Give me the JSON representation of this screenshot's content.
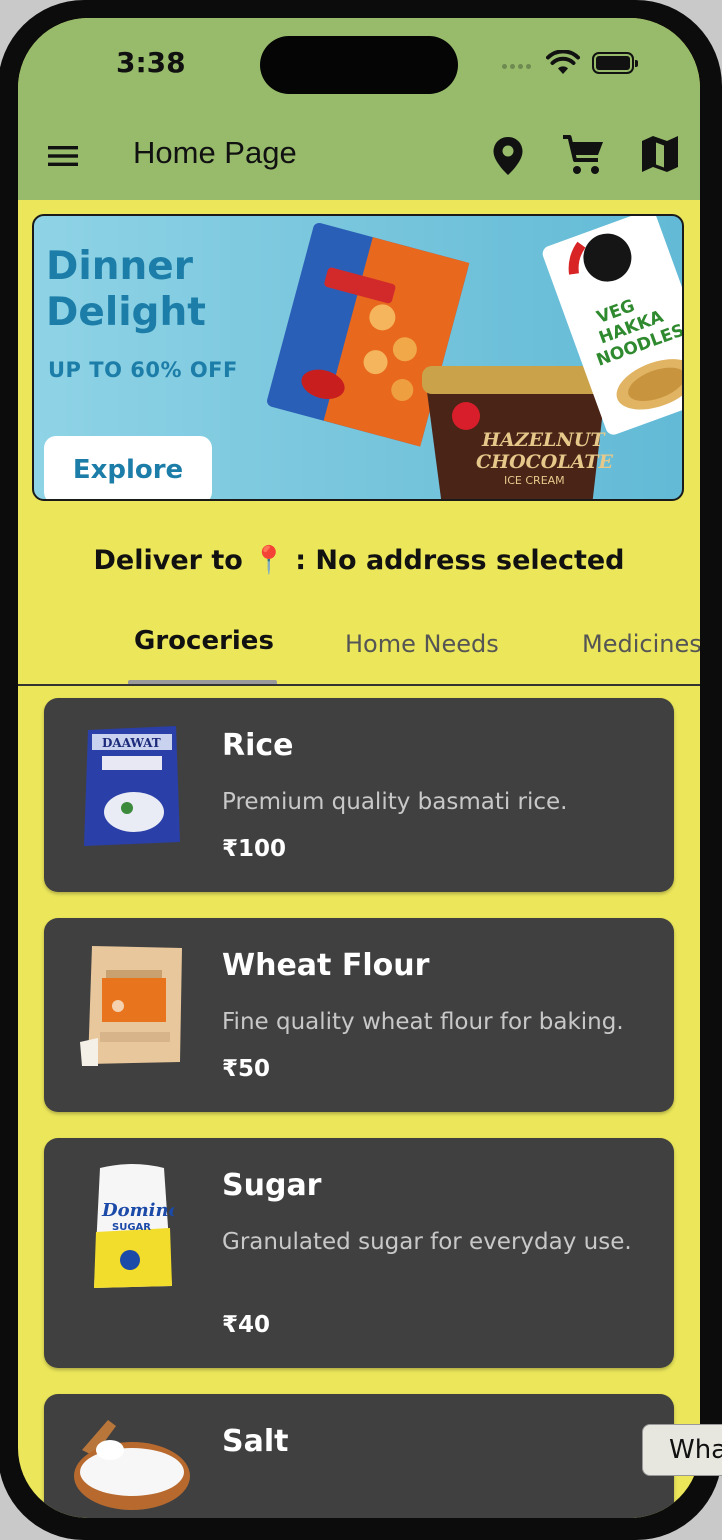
{
  "status_bar": {
    "time": "3:38"
  },
  "app_bar": {
    "title": "Home Page"
  },
  "banner": {
    "title": "Dinner Delight",
    "offer": "UP TO 60% OFF",
    "explore_label": "Explore"
  },
  "delivery": {
    "label": "Deliver to 📍 : No address selected"
  },
  "tabs": [
    {
      "label": "Groceries",
      "active": true
    },
    {
      "label": "Home Needs",
      "active": false
    },
    {
      "label": "Medicines",
      "active": false
    }
  ],
  "products": [
    {
      "name": "Rice",
      "description": "Premium quality basmati rice.",
      "price": "₹100",
      "image": "rice-bag-icon"
    },
    {
      "name": "Wheat Flour",
      "description": "Fine quality wheat flour for baking.",
      "price": "₹50",
      "image": "flour-bag-icon"
    },
    {
      "name": "Sugar",
      "description": "Granulated sugar for everyday use.",
      "price": "₹40",
      "image": "sugar-bag-icon"
    },
    {
      "name": "Salt",
      "description": "",
      "price": "",
      "image": "salt-bowl-icon"
    }
  ],
  "overlay_chip": {
    "label": "Wha"
  },
  "colors": {
    "app_bar": "#97bb6b",
    "background": "#ebe65a",
    "card": "#404040",
    "banner_text": "#1c7ea8"
  }
}
